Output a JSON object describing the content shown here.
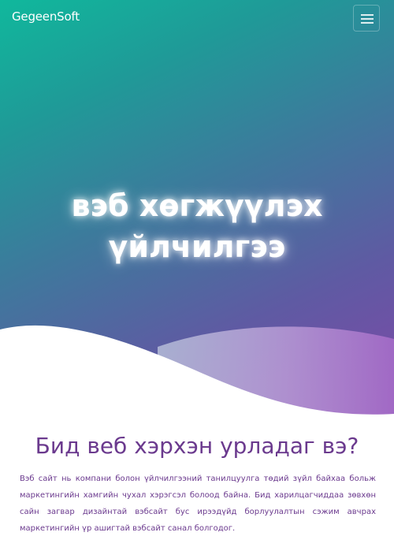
{
  "navbar": {
    "brand": "GegeenSoft",
    "menu_icon": "hamburger-menu-icon"
  },
  "hero": {
    "title": "вэб хөгжүүлэх үйлчилгээ",
    "gradient_colors": [
      "#10b89c",
      "#3c7b9c",
      "#8147a8"
    ]
  },
  "section": {
    "title": "Бид веб хэрхэн урладаг вэ?",
    "body": "Вэб сайт нь компани болон үйлчилгээний танилцуулга төдий зүйл байхаа больж маркетингийн хамгийн чухал хэрэгсэл болоод байна. Бид харилцагчиддаа зөвхөн сайн загвар дизайнтай вэбсайт бус ирээдүйд борлуулалтын сэжим авчрах маркетингийн үр ашигтай вэбсайт санал болгодог.",
    "text_color": "#6b3a8e"
  }
}
